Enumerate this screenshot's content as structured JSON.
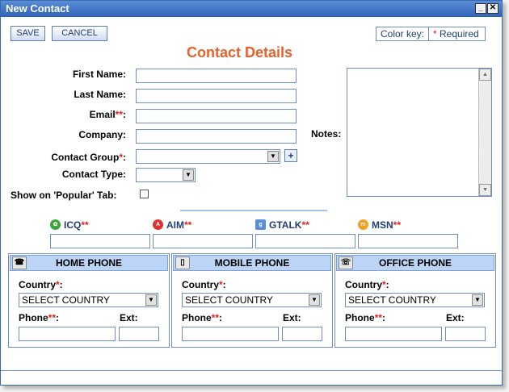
{
  "window": {
    "title": "New Contact",
    "minimize": "_",
    "close": "✕"
  },
  "toolbar": {
    "save_label": "SAVE",
    "cancel_label": "CANCEL"
  },
  "color_key": {
    "label": "Color key:",
    "star": "*",
    "required": "Required"
  },
  "heading": "Contact Details",
  "form": {
    "first_name": "First Name:",
    "last_name": "Last Name:",
    "email": "Email",
    "email_stars": "**",
    "company": "Company:",
    "contact_group": "Contact Group",
    "contact_group_star": "*",
    "contact_type": "Contact Type:",
    "popular_tab": "Show on 'Popular' Tab:",
    "notes": "Notes:",
    "add_group": "+"
  },
  "im": [
    {
      "name": "ICQ",
      "stars": "**"
    },
    {
      "name": "AIM",
      "stars": "**"
    },
    {
      "name": "GTALK",
      "stars": "**"
    },
    {
      "name": "MSN",
      "stars": "**"
    }
  ],
  "phones": [
    {
      "title": "HOME PHONE",
      "country": "Country",
      "country_star": "*",
      "country_value": "SELECT COUNTRY",
      "phone": "Phone",
      "phone_stars": "**",
      "ext": "Ext:"
    },
    {
      "title": "MOBILE PHONE",
      "country": "Country",
      "country_star": "*",
      "country_value": "SELECT COUNTRY",
      "phone": "Phone",
      "phone_stars": "**",
      "ext": "Ext:"
    },
    {
      "title": "OFFICE PHONE",
      "country": "Country",
      "country_star": "*",
      "country_value": "SELECT COUNTRY",
      "phone": "Phone",
      "phone_stars": "**",
      "ext": "Ext:"
    }
  ],
  "colors": {
    "accent": "#e8602a",
    "required": "#e02020",
    "border": "#6f8fc0",
    "titlebar": "#2f62b5"
  }
}
